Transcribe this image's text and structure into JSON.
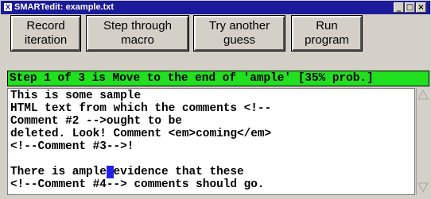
{
  "window": {
    "title": "SMARTedit: example.txt",
    "app_icon": "X",
    "controls": {
      "minimize": "_",
      "maximize": "□",
      "close": "×"
    }
  },
  "toolbar": {
    "record_label": "Record\niteration",
    "step_label": "Step through\nmacro",
    "try_label": "Try another\nguess",
    "run_label": "Run\nprogram"
  },
  "status": {
    "text": "Step 1 of 3 is Move to the end of 'ample' [35% prob.]",
    "color": "#20e020"
  },
  "editor": {
    "lines": [
      "This is some sample",
      "HTML text from which the comments <!--",
      "Comment #2 -->ought to be",
      "deleted. Look! Comment <em>coming</em>",
      "<!--Comment #3-->!",
      "",
      "There is ample",
      "evidence that these",
      "<!--Comment #4--> comments should go."
    ],
    "cursor_color": "#2020e8"
  },
  "scrollbar": {
    "up_icon": "up-arrow-icon",
    "down_icon": "down-arrow-icon"
  }
}
